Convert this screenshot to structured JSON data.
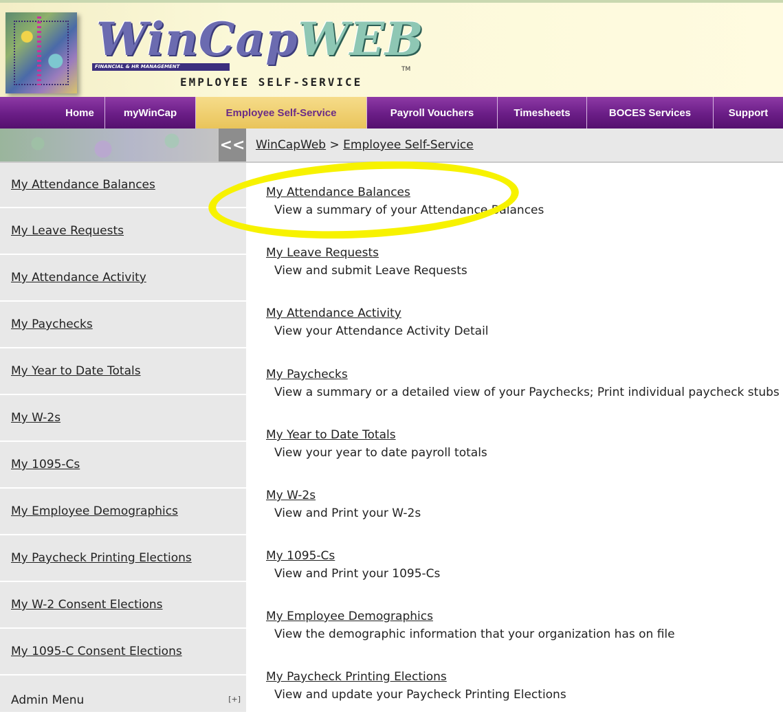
{
  "header": {
    "brand_main": "WinCap",
    "brand_accent": "WEB",
    "brand_tag": "FINANCIAL & HR MANAGEMENT",
    "brand_sub": "EMPLOYEE SELF-SERVICE",
    "trademark": "TM"
  },
  "topnav": {
    "tabs": [
      {
        "label": "Home"
      },
      {
        "label": "myWinCap"
      },
      {
        "label": "Employee Self-Service",
        "active": true
      },
      {
        "label": "Payroll Vouchers"
      },
      {
        "label": "Timesheets"
      },
      {
        "label": "BOCES Services"
      },
      {
        "label": "Support"
      }
    ]
  },
  "breadcrumb": {
    "collapse_glyph": "<<",
    "root": "WinCapWeb",
    "separator": " > ",
    "current": "Employee Self-Service"
  },
  "sidebar": {
    "items": [
      {
        "label": "My Attendance Balances"
      },
      {
        "label": "My Leave Requests"
      },
      {
        "label": "My Attendance Activity"
      },
      {
        "label": "My Paychecks"
      },
      {
        "label": "My Year to Date Totals"
      },
      {
        "label": "My W-2s"
      },
      {
        "label": "My 1095-Cs"
      },
      {
        "label": "My Employee Demographics"
      },
      {
        "label": "My Paycheck Printing Elections"
      },
      {
        "label": "My W-2 Consent Elections"
      },
      {
        "label": "My 1095-C Consent Elections"
      }
    ],
    "admin_label": "Admin Menu",
    "admin_toggle": "[+]"
  },
  "main": {
    "entries": [
      {
        "title": "My Attendance Balances",
        "desc": "View a summary of your Attendance Balances"
      },
      {
        "title": "My Leave Requests",
        "desc": "View and submit Leave Requests"
      },
      {
        "title": "My Attendance Activity",
        "desc": "View your Attendance Activity Detail"
      },
      {
        "title": "My Paychecks",
        "desc": "View a summary or a detailed view of your Paychecks; Print individual paycheck stubs"
      },
      {
        "title": "My Year to Date Totals",
        "desc": "View your year to date payroll totals"
      },
      {
        "title": "My W-2s",
        "desc": "View and Print your W-2s"
      },
      {
        "title": "My 1095-Cs",
        "desc": "View and Print your 1095-Cs"
      },
      {
        "title": "My Employee Demographics",
        "desc": "View the demographic information that your organization has on file"
      },
      {
        "title": "My Paycheck Printing Elections",
        "desc": "View and update your Paycheck Printing Elections"
      }
    ]
  },
  "colors": {
    "nav_purple": "#6a1d86",
    "nav_active": "#f0d27a",
    "highlight": "#f7f200",
    "sidebar_bg": "#e8e8e8"
  }
}
